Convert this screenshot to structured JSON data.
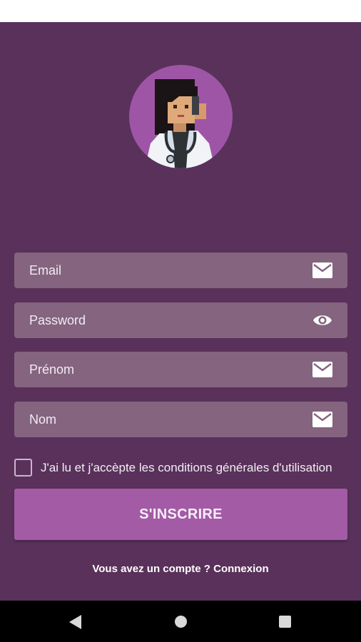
{
  "form": {
    "email": {
      "label": "Email",
      "icon": "mail-icon"
    },
    "password": {
      "label": "Password",
      "icon": "eye-icon"
    },
    "prenom": {
      "label": "Prénom",
      "icon": "mail-icon"
    },
    "nom": {
      "label": "Nom",
      "icon": "mail-icon"
    }
  },
  "terms": {
    "label": "J'ai lu et j'accèpte les conditions générales d'utilisation",
    "checked": false
  },
  "submit": {
    "label": "S'INSCRIRE"
  },
  "footer": {
    "text": "Vous avez un compte ? Connexion"
  },
  "avatar": {
    "icon": "doctor-avatar-icon"
  },
  "nav": {
    "back": "back-icon",
    "home": "home-icon",
    "recent": "recent-apps-icon"
  },
  "colors": {
    "background": "#59315b",
    "field": "#84647f",
    "accent": "#a35ba6",
    "avatar_bg": "#9f55a6"
  }
}
